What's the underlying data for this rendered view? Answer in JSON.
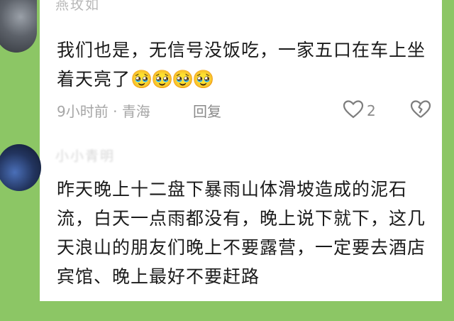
{
  "comments": [
    {
      "username": "燕玫如",
      "text": "我们也是，无信号没饭吃，一家五口在车上坐着天亮了",
      "emojis": "🥹🥹🥹🥹",
      "time": "9小时前",
      "location": "青海",
      "reply_label": "回复",
      "like_count": "2"
    },
    {
      "username": "小小青明",
      "text": "昨天晚上十二盘下暴雨山体滑坡造成的泥石流，白天一点雨都没有，晚上说下就下，这几天浪山的朋友们晚上不要露营，一定要去酒店宾馆、晚上最好不要赶路"
    }
  ],
  "icons": {
    "like": "heart-outline-icon",
    "dislike": "broken-heart-icon"
  },
  "colors": {
    "background": "#8cc665",
    "card": "#ffffff",
    "text": "#1a1a1a",
    "meta": "#a6a6a6"
  }
}
